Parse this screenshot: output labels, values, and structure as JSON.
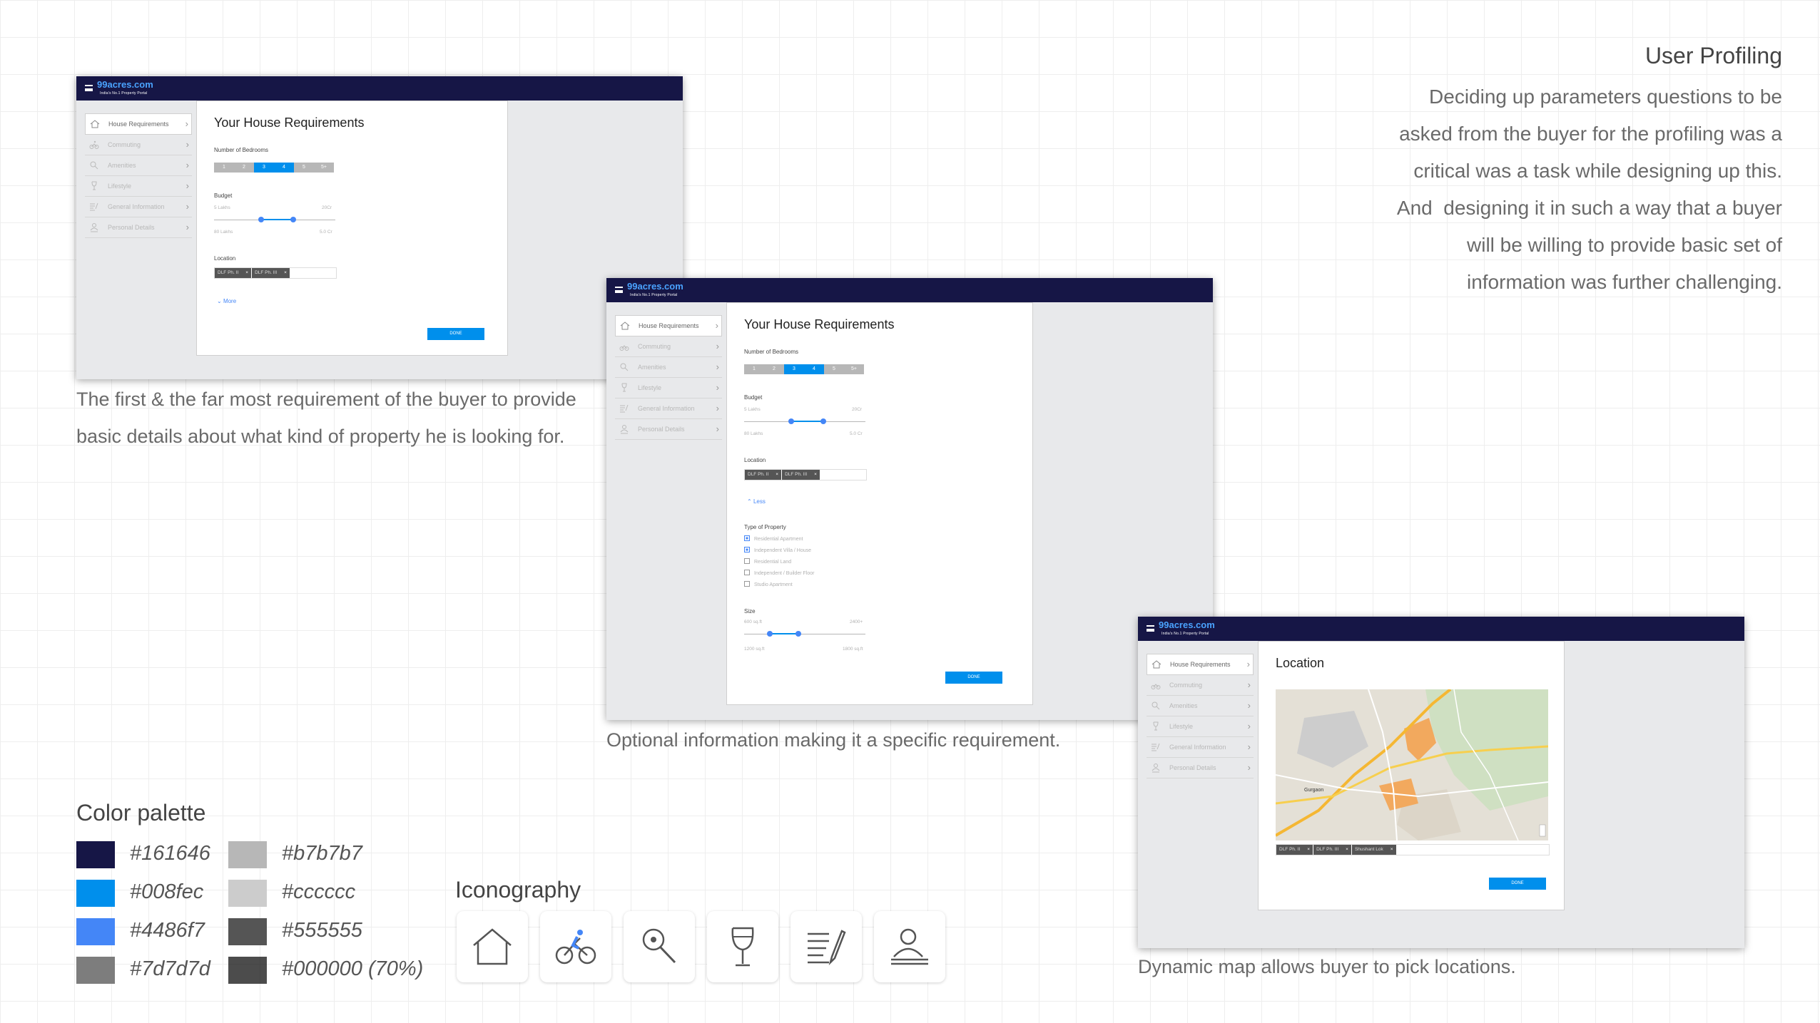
{
  "app": {
    "logo": "99acres.com",
    "tagline": "India's No.1 Property Portal"
  },
  "sidebar": {
    "items": [
      {
        "label": "House Requirements",
        "icon": "house-icon"
      },
      {
        "label": "Commuting",
        "icon": "bicycle-icon"
      },
      {
        "label": "Amenities",
        "icon": "magnifier-icon"
      },
      {
        "label": "Lifestyle",
        "icon": "wine-glass-icon"
      },
      {
        "label": "General Information",
        "icon": "document-pen-icon"
      },
      {
        "label": "Personal Details",
        "icon": "person-icon"
      }
    ]
  },
  "form": {
    "title": "Your House Requirements",
    "bedrooms_label": "Number of Bedrooms",
    "bedrooms": [
      "1",
      "2",
      "3",
      "4",
      "5",
      "5+"
    ],
    "bedrooms_selected": [
      "3",
      "4"
    ],
    "budget_label": "Budget",
    "budget_min": "5 Lakhs",
    "budget_max": "20Cr",
    "budget_low": "80 Lakhs",
    "budget_high": "5.0 Cr",
    "location_label": "Location",
    "chips": [
      "DLF Ph. II",
      "DLF Ph. III"
    ],
    "chip_close": "×",
    "more": "More",
    "less": "Less",
    "property_type_label": "Type of Property",
    "property_types": [
      "Residential Apartment",
      "Independent Villa / House",
      "Residential Land",
      "Independent / Builder Floor",
      "Studio Apartment"
    ],
    "property_types_checked": [
      true,
      true,
      false,
      false,
      false
    ],
    "size_label": "Size",
    "size_min": "600 sq.ft",
    "size_max": "2400+",
    "size_low": "1200 sq.ft",
    "size_high": "1800 sq.ft",
    "done": "DONE"
  },
  "location_screen": {
    "title": "Location",
    "chips": [
      "DLF Ph. II",
      "DLF Ph. III",
      "Shushant Lok"
    ],
    "map_label": "Gurgaon",
    "done": "DONE"
  },
  "captions": {
    "first": "The first & the far most requirement of the buyer to provide basic details about what kind of property he is looking for.",
    "second": "Optional information making it a specific requirement.",
    "third": "Dynamic map allows buyer to pick locations."
  },
  "profiling": {
    "heading": "User Profiling",
    "lines": [
      "Deciding up parameters questions to be",
      "asked from the buyer for the profiling was a",
      "critical was a task while designing up this.",
      "And  designing it in such a way that a buyer",
      "will be willing to provide basic set of",
      "information was further challenging."
    ]
  },
  "palette": {
    "heading": "Color palette",
    "colors": [
      {
        "hex": "#161646",
        "label": "#161646"
      },
      {
        "hex": "#008fec",
        "label": "#008fec"
      },
      {
        "hex": "#4486f7",
        "label": "#4486f7"
      },
      {
        "hex": "#7d7d7d",
        "label": "#7d7d7d"
      },
      {
        "hex": "#b7b7b7",
        "label": "#b7b7b7"
      },
      {
        "hex": "#cccccc",
        "label": "#cccccc"
      },
      {
        "hex": "#555555",
        "label": "#555555"
      },
      {
        "hex": "#000000",
        "label": "#000000 (70%)"
      }
    ]
  },
  "iconography": {
    "heading": "Iconography",
    "icons": [
      "house-icon",
      "bicycle-icon",
      "magnifier-icon",
      "wine-glass-icon",
      "document-pen-icon",
      "person-icon"
    ]
  }
}
